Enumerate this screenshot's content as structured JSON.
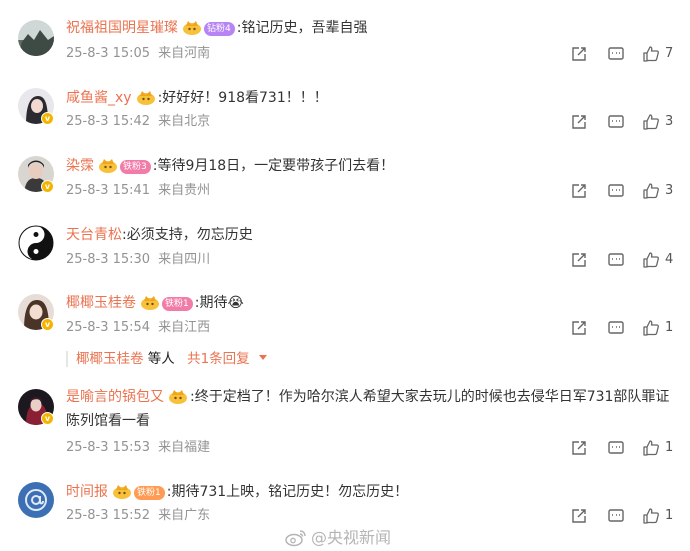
{
  "comments": [
    {
      "name": "祝福祖国明星璀璨",
      "fan": "钻粉4",
      "fan_color": "#b784f5",
      "text": ":铭记历史，吾辈自强",
      "date": "25-8-3 15:05",
      "location": "来自河南",
      "likes": "7",
      "avatar": "landscape-avatar"
    },
    {
      "name": "咸鱼酱_xy",
      "fan": "",
      "text": ":好好好！918看731！！！",
      "date": "25-8-3 15:42",
      "location": "来自北京",
      "likes": "3",
      "avatar": "girl-avatar"
    },
    {
      "name": "染霂",
      "fan": "铁粉3",
      "fan_color": "#f27ca8",
      "text": ":等待9月18日，一定要带孩子们去看！",
      "date": "25-8-3 15:41",
      "location": "来自贵州",
      "likes": "3",
      "avatar": "man-avatar"
    },
    {
      "name": "天台青松",
      "fan": "",
      "text": ":必须支持，勿忘历史",
      "date": "25-8-3 15:30",
      "location": "来自四川",
      "likes": "4",
      "avatar": "yinyang-avatar"
    },
    {
      "name": "椰椰玉桂卷",
      "fan": "铁粉1",
      "fan_color": "#f27ca8",
      "text": ":期待😭",
      "date": "25-8-3 15:54",
      "location": "来自江西",
      "likes": "1",
      "avatar": "girl2-avatar"
    },
    {
      "name": "是喻言的锅包又",
      "fan": "",
      "text": ":终于定档了！作为哈尔滨人希望大家去玩儿的时候也去侵华日军731部队罪证陈列馆看一看",
      "date": "25-8-3 15:53",
      "location": "来自福建",
      "likes": "1",
      "avatar": "dark-avatar"
    },
    {
      "name": "时间报",
      "fan": "铁粉1",
      "fan_color": "#ff9b52",
      "text": ":期待731上映，铭记历史！勿忘历史！",
      "date": "25-8-3 15:52",
      "location": "来自广东",
      "likes": "1",
      "avatar": "at-avatar"
    }
  ],
  "replies": {
    "name": "椰椰玉桂卷",
    "suffix": "等人",
    "count": "共1条回复"
  },
  "watermark": "@央视新闻",
  "colors": {
    "name": "#eb7350",
    "meta": "#939393",
    "badge": "#f5b400"
  }
}
